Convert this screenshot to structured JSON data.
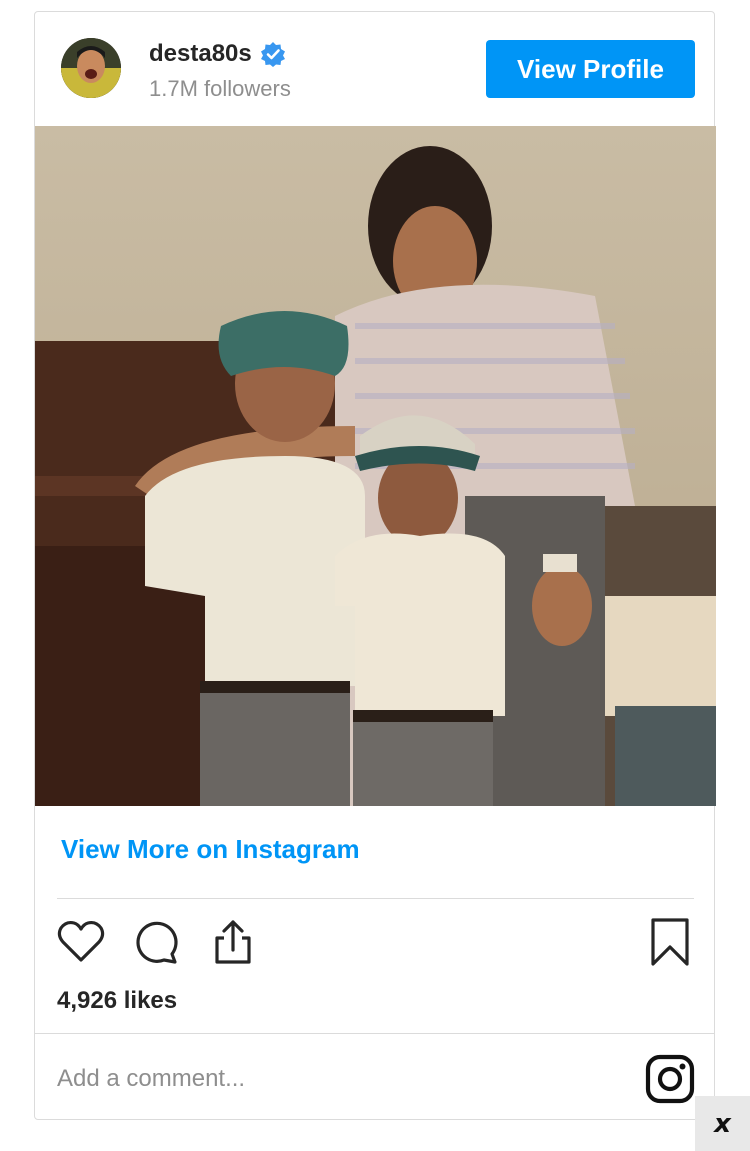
{
  "post": {
    "username": "desta80s",
    "followers": "1.7M followers",
    "view_profile_label": "View Profile",
    "view_more_label": "View More on Instagram",
    "likes": "4,926 likes",
    "comment_placeholder": "Add a comment..."
  },
  "icons": {
    "verified": "verified-badge-icon",
    "like": "heart-icon",
    "comment": "comment-bubble-icon",
    "share": "share-icon",
    "save": "bookmark-icon",
    "instagram": "instagram-logo-icon",
    "close": "close-icon"
  },
  "ad_close": {
    "label": "x"
  },
  "colors": {
    "accent": "#0095f6",
    "text": "#262626",
    "muted": "#8e8e8e",
    "border": "#dbdbdb"
  }
}
